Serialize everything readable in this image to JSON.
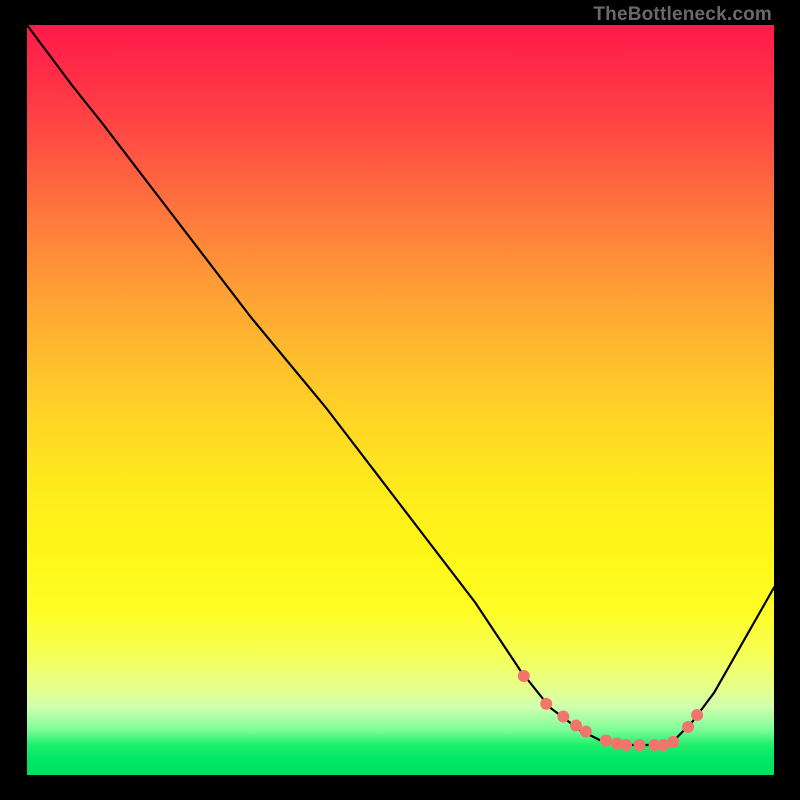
{
  "watermark": "TheBottleneck.com",
  "colors": {
    "curve": "#000000",
    "dot_fill": "#f2756c",
    "dot_stroke": "#f2756c"
  },
  "chart_data": {
    "type": "line",
    "title": "",
    "xlabel": "",
    "ylabel": "",
    "xlim": [
      0,
      100
    ],
    "ylim": [
      0,
      100
    ],
    "grid": false,
    "legend": false,
    "x": [
      0,
      6,
      10,
      20,
      30,
      40,
      50,
      60,
      66,
      70,
      74,
      77,
      80,
      83,
      86,
      89,
      92,
      100
    ],
    "y": [
      100,
      92,
      87,
      74,
      61,
      49,
      36,
      23,
      14,
      9,
      6,
      4.5,
      4,
      4,
      4,
      7,
      11,
      25
    ],
    "markers_x": [
      66.5,
      69.5,
      71.8,
      73.5,
      74.8,
      77.5,
      79.0,
      80.2,
      82.0,
      84.0,
      85.2,
      86.5,
      88.5,
      89.7
    ],
    "markers_y": [
      13.2,
      9.5,
      7.8,
      6.6,
      5.8,
      4.6,
      4.2,
      4.0,
      4.0,
      4.0,
      4.0,
      4.4,
      6.4,
      8.0
    ]
  }
}
